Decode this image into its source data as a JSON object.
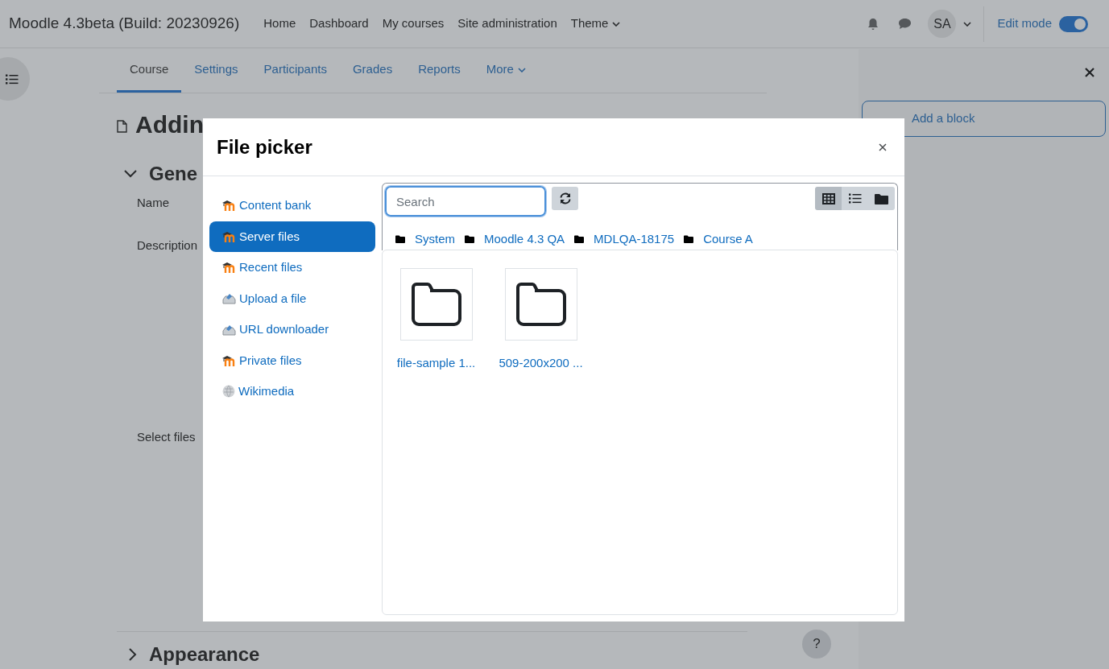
{
  "navbar": {
    "site_name": "Moodle 4.3beta (Build: 20230926)",
    "links": [
      {
        "label": "Home",
        "kind": "link"
      },
      {
        "label": "Dashboard",
        "kind": "link"
      },
      {
        "label": "My courses",
        "kind": "link"
      },
      {
        "label": "Site administration",
        "kind": "link"
      },
      {
        "label": "Theme",
        "kind": "dropdown"
      }
    ],
    "avatar": "SA",
    "edit_mode": {
      "label": "Edit mode",
      "on": true
    }
  },
  "course_tabs": [
    {
      "label": "Course",
      "selected": true,
      "kind": "link"
    },
    {
      "label": "Settings",
      "selected": false,
      "kind": "link"
    },
    {
      "label": "Participants",
      "selected": false,
      "kind": "link"
    },
    {
      "label": "Grades",
      "selected": false,
      "kind": "link"
    },
    {
      "label": "Reports",
      "selected": false,
      "kind": "link"
    },
    {
      "label": "More",
      "selected": false,
      "kind": "dropdown"
    }
  ],
  "page": {
    "heading": "Addin",
    "section": {
      "title": "Gene",
      "expanded": true
    },
    "fields": [
      "Name",
      "Description",
      "Select files"
    ],
    "collapsed_section": {
      "title": "Appearance",
      "expanded": false
    }
  },
  "block_drawer": {
    "add_block": "Add a block"
  },
  "help": "?",
  "file_picker": {
    "title": "File picker",
    "repositories": [
      {
        "label": "Content bank",
        "kind": "moodle",
        "selected": false
      },
      {
        "label": "Server files",
        "kind": "moodle",
        "selected": true
      },
      {
        "label": "Recent files",
        "kind": "moodle",
        "selected": false
      },
      {
        "label": "Upload a file",
        "kind": "upload",
        "selected": false
      },
      {
        "label": "URL downloader",
        "kind": "upload",
        "selected": false
      },
      {
        "label": "Private files",
        "kind": "moodle",
        "selected": false
      },
      {
        "label": "Wikimedia",
        "kind": "wiki",
        "selected": false
      }
    ],
    "search": {
      "placeholder": "Search"
    },
    "views": [
      {
        "kind": "icons",
        "selected": true
      },
      {
        "kind": "list",
        "selected": false
      },
      {
        "kind": "tree",
        "selected": false
      }
    ],
    "breadcrumb": [
      "System",
      "Moodle 4.3 QA",
      "MDLQA-18175",
      "Course A"
    ],
    "files": [
      {
        "name": "file-sample 1..."
      },
      {
        "name": "509-200x200 ..."
      }
    ]
  }
}
